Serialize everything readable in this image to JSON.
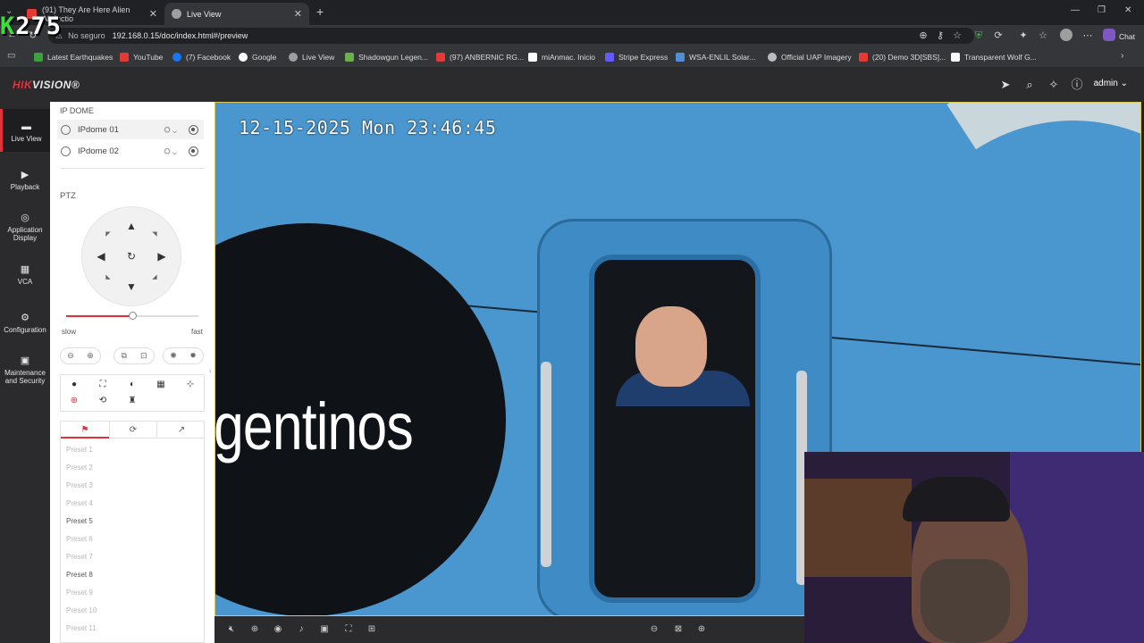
{
  "overlay": {
    "score_prefix": "K",
    "score": "275"
  },
  "browser": {
    "tabs": [
      {
        "label": "(91) They Are Here Alien Abductio",
        "icon": "youtube-icon"
      },
      {
        "label": "Live View",
        "icon": "globe-icon"
      }
    ],
    "url": "192.168.0.15/doc/index.html#/preview",
    "security_label": "No seguro",
    "bookmarks": [
      {
        "label": "Latest Earthquakes",
        "color": "#3e9f3e"
      },
      {
        "label": "YouTube",
        "color": "#e53935"
      },
      {
        "label": "(7) Facebook",
        "color": "#1877f2"
      },
      {
        "label": "Google",
        "color": "#ffffff"
      },
      {
        "label": "Live View",
        "color": "#9e9e9e"
      },
      {
        "label": "Shadowgun Legen...",
        "color": "#6ab04c"
      },
      {
        "label": "(97) ANBERNIC RG...",
        "color": "#e53935"
      },
      {
        "label": "miAnmac. Inicio",
        "color": "#ffffff"
      },
      {
        "label": "Stripe Express",
        "color": "#635bff"
      },
      {
        "label": "WSA-ENLIL Solar...",
        "color": "#4f8fd8"
      },
      {
        "label": "Official UAP Imagery",
        "color": "#bdbdbd"
      },
      {
        "label": "(20) Demo 3D[SBS]...",
        "color": "#e53935"
      },
      {
        "label": "Transparent Wolf G...",
        "color": "#fafafa"
      }
    ],
    "chat_label": "Chat"
  },
  "app": {
    "brand": "HIK",
    "brand_rest": "VISION",
    "user": "admin",
    "nav": [
      {
        "label": "Live View",
        "icon": "live-view-icon"
      },
      {
        "label": "Playback",
        "icon": "playback-icon"
      },
      {
        "label": "Application Display",
        "icon": "application-icon"
      },
      {
        "label": "VCA",
        "icon": "vca-icon"
      },
      {
        "label": "Configuration",
        "icon": "gear-icon"
      },
      {
        "label": "Maintenance and Security",
        "icon": "maintenance-icon"
      }
    ]
  },
  "panel": {
    "group_title": "IP DOME",
    "cameras": [
      "IPdome 01",
      "IPdome 02"
    ],
    "ptz_title": "PTZ",
    "speed": {
      "slow": "slow",
      "fast": "fast",
      "level": 0.5
    },
    "presets": [
      {
        "label": "Preset 1",
        "set": false
      },
      {
        "label": "Preset 2",
        "set": false
      },
      {
        "label": "Preset 3",
        "set": false
      },
      {
        "label": "Preset 4",
        "set": false
      },
      {
        "label": "Preset 5",
        "set": true
      },
      {
        "label": "Preset 6",
        "set": false
      },
      {
        "label": "Preset 7",
        "set": false
      },
      {
        "label": "Preset 8",
        "set": true
      },
      {
        "label": "Preset 9",
        "set": false
      },
      {
        "label": "Preset 10",
        "set": false
      },
      {
        "label": "Preset 11",
        "set": false
      }
    ]
  },
  "video": {
    "timestamp": "12-15-2025 Mon 23:46:45",
    "signage": "gentinos"
  }
}
